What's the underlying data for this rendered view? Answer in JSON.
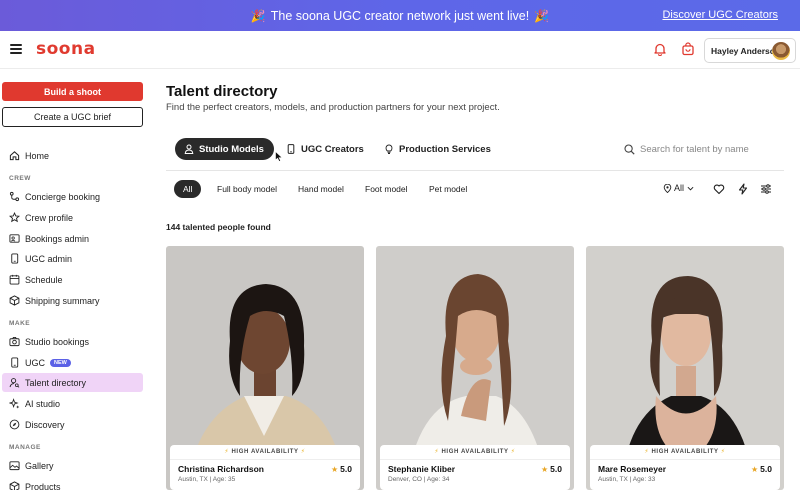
{
  "banner": {
    "text": "The soona UGC creator network just went live!",
    "emoji_left": "🎉",
    "emoji_right": "🎉",
    "link": "Discover UGC Creators"
  },
  "header": {
    "logo": "soona",
    "user_name": "Hayley Anderson",
    "accent": "#e0392f"
  },
  "sidebar": {
    "build_button": "Build a shoot",
    "brief_button": "Create a UGC brief",
    "home": "Home",
    "sections": {
      "crew": "CREW",
      "make": "MAKE",
      "manage": "MANAGE"
    },
    "crew_items": [
      "Concierge booking",
      "Crew profile",
      "Bookings admin",
      "UGC admin",
      "Schedule",
      "Shipping summary"
    ],
    "make_items": [
      "Studio bookings",
      "UGC",
      "Talent directory",
      "AI studio",
      "Discovery"
    ],
    "manage_items": [
      "Gallery",
      "Products"
    ],
    "ugc_badge": "NEW",
    "active_item": "Talent directory"
  },
  "main": {
    "title": "Talent directory",
    "subtitle": "Find the perfect creators, models, and production partners for your next project.",
    "tabs": [
      "Studio Models",
      "UGC Creators",
      "Production Services"
    ],
    "search_placeholder": "Search for talent by name",
    "filters": [
      "All",
      "Full body model",
      "Hand model",
      "Foot model",
      "Pet model"
    ],
    "location_filter": "All",
    "results_count": "144 talented people found"
  },
  "cards": [
    {
      "availability": "HIGH AVAILABILITY",
      "name": "Christina Richardson",
      "meta": "Austin, TX | Age: 35",
      "rating": "5.0"
    },
    {
      "availability": "HIGH AVAILABILITY",
      "name": "Stephanie Kliber",
      "meta": "Denver, CO | Age: 34",
      "rating": "5.0"
    },
    {
      "availability": "HIGH AVAILABILITY",
      "name": "Mare Rosemeyer",
      "meta": "Austin, TX | Age: 33",
      "rating": "5.0"
    }
  ]
}
